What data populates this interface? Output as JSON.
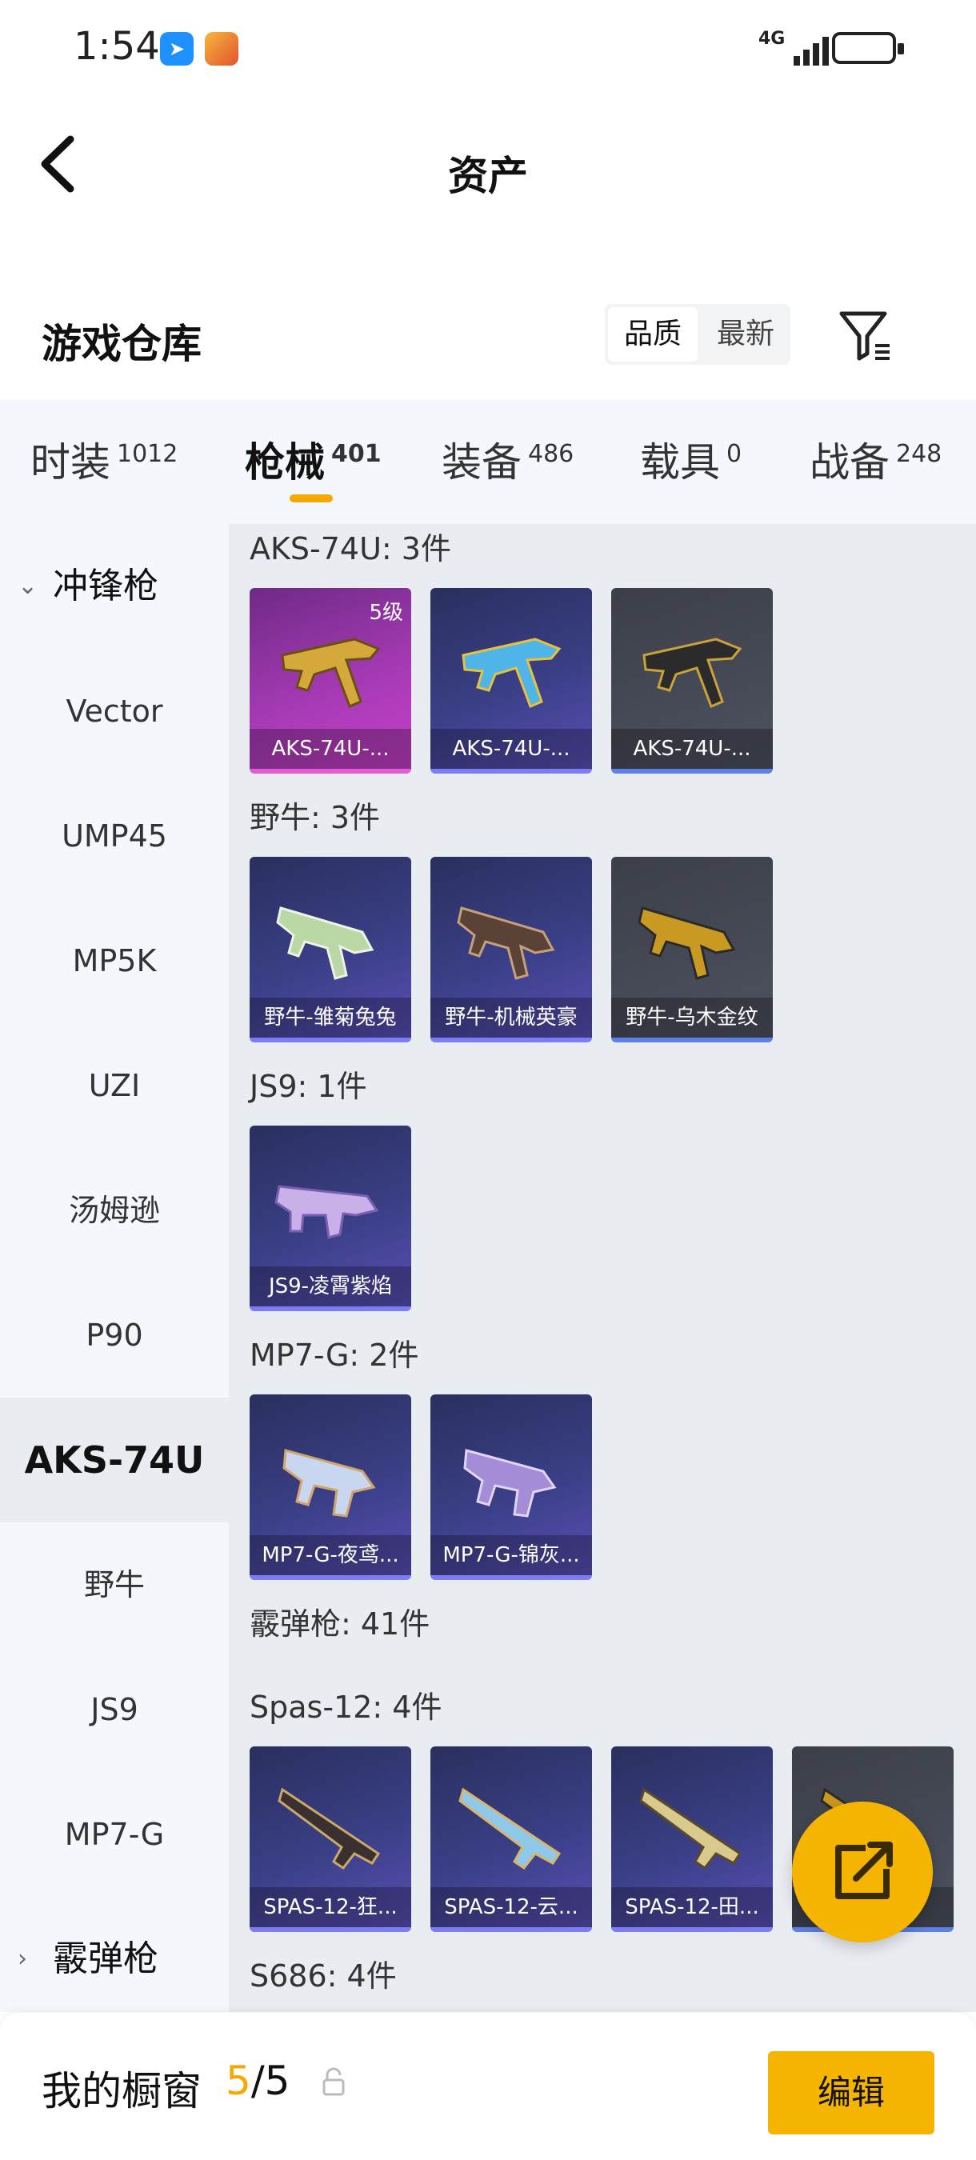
{
  "status": {
    "time": "1:54",
    "network": "4G"
  },
  "header": {
    "title": "资产"
  },
  "warehouse": {
    "title": "游戏仓库",
    "sort_options": [
      "品质",
      "最新"
    ]
  },
  "tabs": [
    {
      "label": "时装",
      "count": "1012"
    },
    {
      "label": "枪械",
      "count": "401"
    },
    {
      "label": "装备",
      "count": "486"
    },
    {
      "label": "载具",
      "count": "0"
    },
    {
      "label": "战备",
      "count": "248"
    }
  ],
  "sidebar": {
    "group1": "冲锋枪",
    "items": [
      "Vector",
      "UMP45",
      "MP5K",
      "UZI",
      "汤姆逊",
      "P90",
      "AKS-74U",
      "野牛",
      "JS9",
      "MP7-G"
    ],
    "group2": "霰弹枪"
  },
  "sections": {
    "aks": {
      "title": "AKS-74U: 3件",
      "cards": [
        "AKS-74U-...",
        "AKS-74U-...",
        "AKS-74U-..."
      ],
      "level": "5级"
    },
    "bison": {
      "title": "野牛: 3件",
      "cards": [
        "野牛-雏菊兔兔",
        "野牛-机械英豪",
        "野牛-乌木金纹"
      ]
    },
    "js9": {
      "title": "JS9: 1件",
      "cards": [
        "JS9-凌霄紫焰"
      ]
    },
    "mp7": {
      "title": "MP7-G: 2件",
      "cards": [
        "MP7-G-夜鸢...",
        "MP7-G-锦灰..."
      ]
    },
    "shotgun": {
      "title": "霰弹枪: 41件"
    },
    "spas": {
      "title": "Spas-12: 4件",
      "cards": [
        "SPAS-12-狂...",
        "SPAS-12-云...",
        "SPAS-12-田...",
        "..."
      ]
    },
    "s686": {
      "title": "S686: 4件"
    }
  },
  "bottom": {
    "label": "我的橱窗",
    "current": "5",
    "total": "/5",
    "edit": "编辑"
  },
  "colors": {
    "accent": "#f5b400",
    "card_purple": "#3a3f86",
    "card_pink": "#a93bb7",
    "card_gray": "#4e5260"
  }
}
